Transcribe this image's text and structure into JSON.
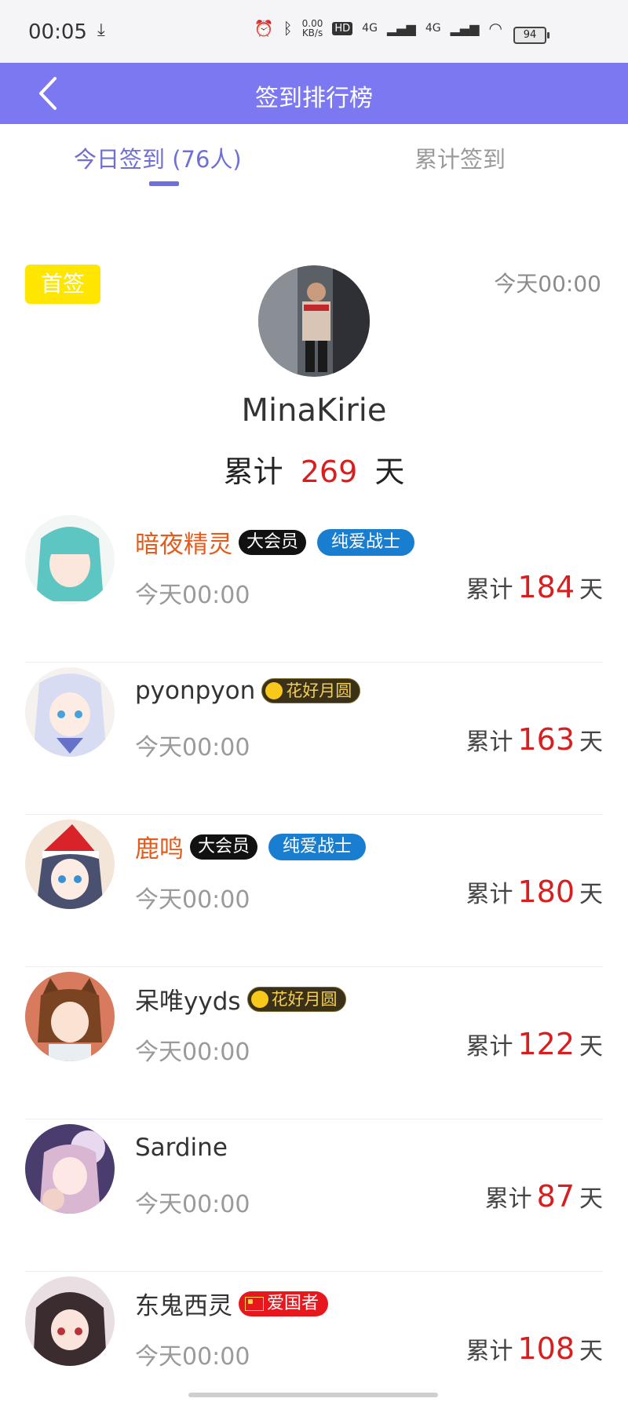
{
  "status_bar": {
    "time": "00:05",
    "speed": "0.00",
    "speed_unit": "KB/s",
    "network_1": "4G",
    "network_2": "4G",
    "hd": "HD",
    "battery": "94"
  },
  "header": {
    "title": "签到排行榜",
    "back_icon": "chevron-left-icon",
    "bg_color": "#7b78f2"
  },
  "tabs": [
    {
      "label": "今日签到 (76人)",
      "active": true
    },
    {
      "label": "累计签到",
      "active": false
    }
  ],
  "champion": {
    "badge": "首签",
    "time": "今天00:00",
    "name": "MinaKirie",
    "days_prefix": "累计",
    "days": "269",
    "days_suffix": "天"
  },
  "list": [
    {
      "name": "暗夜精灵",
      "vip": true,
      "badges": [
        "大会员",
        "纯爱战士"
      ],
      "time": "今天00:00",
      "days_prefix": "累计",
      "days": "184",
      "days_suffix": "天"
    },
    {
      "name": "pyonpyon",
      "vip": false,
      "badges": [
        "花好月圆"
      ],
      "time": "今天00:00",
      "days_prefix": "累计",
      "days": "163",
      "days_suffix": "天"
    },
    {
      "name": "鹿鸣",
      "vip": true,
      "badges": [
        "大会员",
        "纯爱战士"
      ],
      "time": "今天00:00",
      "days_prefix": "累计",
      "days": "180",
      "days_suffix": "天"
    },
    {
      "name": "呆唯yyds",
      "vip": false,
      "badges": [
        "花好月圆"
      ],
      "time": "今天00:00",
      "days_prefix": "累计",
      "days": "122",
      "days_suffix": "天"
    },
    {
      "name": "Sardine",
      "vip": false,
      "badges": [],
      "time": "今天00:00",
      "days_prefix": "累计",
      "days": "87",
      "days_suffix": "天"
    },
    {
      "name": "东鬼西灵",
      "vip": false,
      "badges": [
        "爱国者"
      ],
      "time": "今天00:00",
      "days_prefix": "累计",
      "days": "108",
      "days_suffix": "天"
    }
  ],
  "colors": {
    "accent": "#6f6fd6",
    "days_red": "#d81e1e",
    "vip_name": "#e05d1f",
    "first_badge": "#ffe600"
  }
}
